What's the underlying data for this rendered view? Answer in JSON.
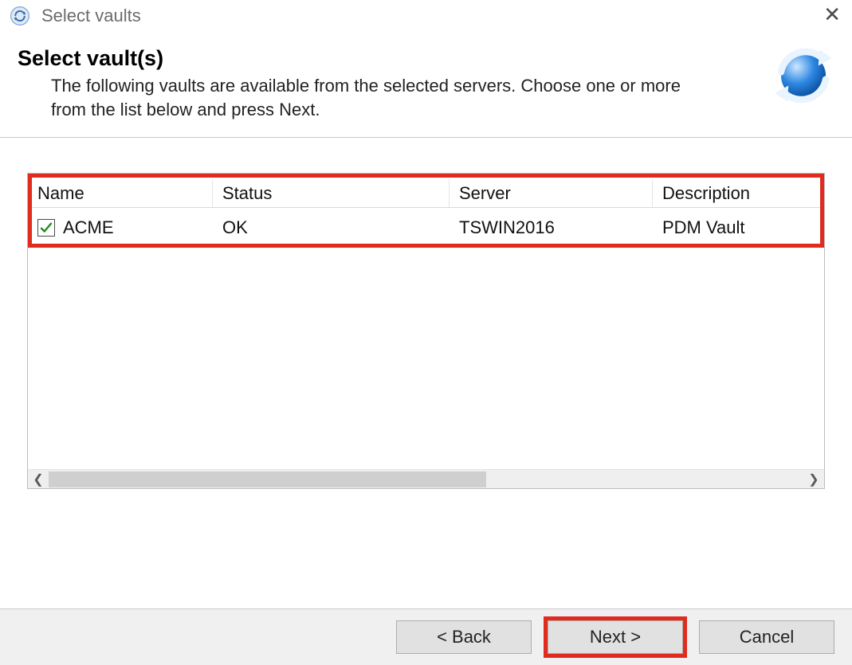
{
  "window": {
    "title": "Select vaults"
  },
  "header": {
    "heading": "Select vault(s)",
    "subtitle": "The following vaults are available from the selected servers. Choose one or more from the list below and press Next."
  },
  "table": {
    "columns": {
      "name": "Name",
      "status": "Status",
      "server": "Server",
      "description": "Description"
    },
    "rows": [
      {
        "checked": true,
        "name": "ACME",
        "status": "OK",
        "server": "TSWIN2016",
        "description": "PDM Vault"
      }
    ]
  },
  "buttons": {
    "back": "< Back",
    "next": "Next >",
    "cancel": "Cancel"
  },
  "colors": {
    "highlight": "#e02b1f"
  }
}
